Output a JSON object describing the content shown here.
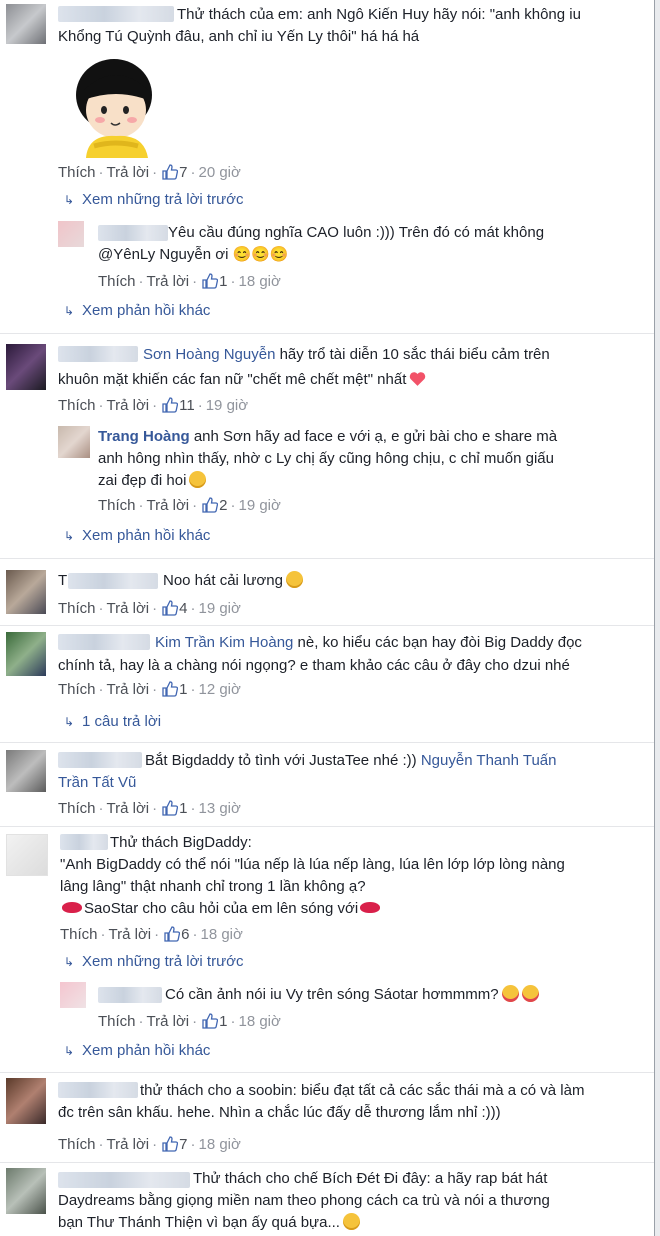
{
  "actions": {
    "like": "Thích",
    "reply": "Trả lời"
  },
  "comments": [
    {
      "id": "c1",
      "author": "",
      "text_line1": "Thử thách của em: anh Ngô Kiến Huy hãy nói: \"anh không iu",
      "text_line2": "Khổng Tú Quỳnh đâu, anh chỉ iu Yến Ly thôi\" há há há",
      "sticker": "girl-sticker-icon",
      "likes": "7",
      "time": "20 giờ",
      "view_previous": "Xem những trả lời trước",
      "replies": [
        {
          "id": "r1",
          "text_line1": "Yêu cầu đúng nghĩa CAO luôn :))) Trên đó có mát không",
          "text_line2": "@YênLy Nguyễn ơi 😊😊😊",
          "likes": "1",
          "time": "18 giờ"
        }
      ],
      "view_more": "Xem phản hồi khác"
    },
    {
      "id": "c2",
      "mention": "Sơn Hoàng Nguyễn",
      "text_line1_rest": " hãy trổ tài diễn 10 sắc thái biểu cảm trên",
      "text_line2": "khuôn mặt khiến các fan nữ \"chết mê chết mệt\" nhất",
      "likes": "11",
      "time": "19 giờ",
      "replies": [
        {
          "id": "r2",
          "author": "Trang Hoàng",
          "text_line1": " anh Sơn hãy ad face e với ạ, e gửi bài cho e share mà",
          "text_line2": "anh hông nhìn thấy, nhờ c Ly chị ấy cũng hông chịu, c chỉ muốn giấu",
          "text_line3": "zai đẹp đi hoi",
          "likes": "2",
          "time": "19 giờ"
        }
      ],
      "view_more": "Xem phản hồi khác"
    },
    {
      "id": "c3",
      "author_initial": "T",
      "text_line1": "Noo hát cải lương",
      "likes": "4",
      "time": "19 giờ"
    },
    {
      "id": "c4",
      "mention": "Kim Trần Kim Hoàng",
      "text_line1_rest": " nè, ko hiểu các bạn hay đòi Big Daddy đọc",
      "text_line2": "chính tả, hay là a chàng nói ngọng? e tham khảo các câu ở đây cho dzui nhé",
      "likes": "1",
      "time": "12 giờ",
      "replies_count": "1 câu trả lời"
    },
    {
      "id": "c5",
      "text_line1": "Bắt Bigdaddy tỏ tình với JustaTee nhé :)) ",
      "mention1": "Nguyễn Thanh Tuấn",
      "mention2": "Trần Tất Vũ",
      "likes": "1",
      "time": "13 giờ"
    },
    {
      "id": "c6",
      "text_line1": "Thử thách BigDaddy:",
      "text_line2": "\"Anh BigDaddy có thể nói \"lúa nếp là lúa nếp làng, lúa lên lớp lớp lòng nàng",
      "text_line3": "lâng lâng\" thật nhanh chỉ trong 1 lần không ạ?",
      "text_line4": "SaoStar cho câu hỏi của em lên sóng với",
      "likes": "6",
      "time": "18 giờ",
      "view_previous": "Xem những trả lời trước",
      "replies": [
        {
          "id": "r3",
          "text_line1": "Có cần ảnh nói iu Vy trên sóng Sáotar hơmmmm?",
          "likes": "1",
          "time": "18 giờ"
        }
      ],
      "view_more": "Xem phản hồi khác"
    },
    {
      "id": "c7",
      "text_line1": "thử thách cho a soobin: biểu đạt tất cả các sắc thái mà a có và làm",
      "text_line2": "đc trên sân khấu. hehe. Nhìn a chắc lúc đấy dễ thương lắm nhỉ :)))",
      "likes": "7",
      "time": "18 giờ"
    },
    {
      "id": "c8",
      "text_line1": "Thử thách cho chế Bích Đét Đi đây: a hãy rap bát hát",
      "text_line2": "Daydreams bằng giọng miền nam theo phong cách ca trù và nói a thương",
      "text_line3": "bạn Thư Thánh Thiện vì bạn ấy quá bựa..."
    }
  ],
  "colors": {
    "link": "#365899",
    "meta": "#90949c",
    "text": "#1d2129"
  }
}
